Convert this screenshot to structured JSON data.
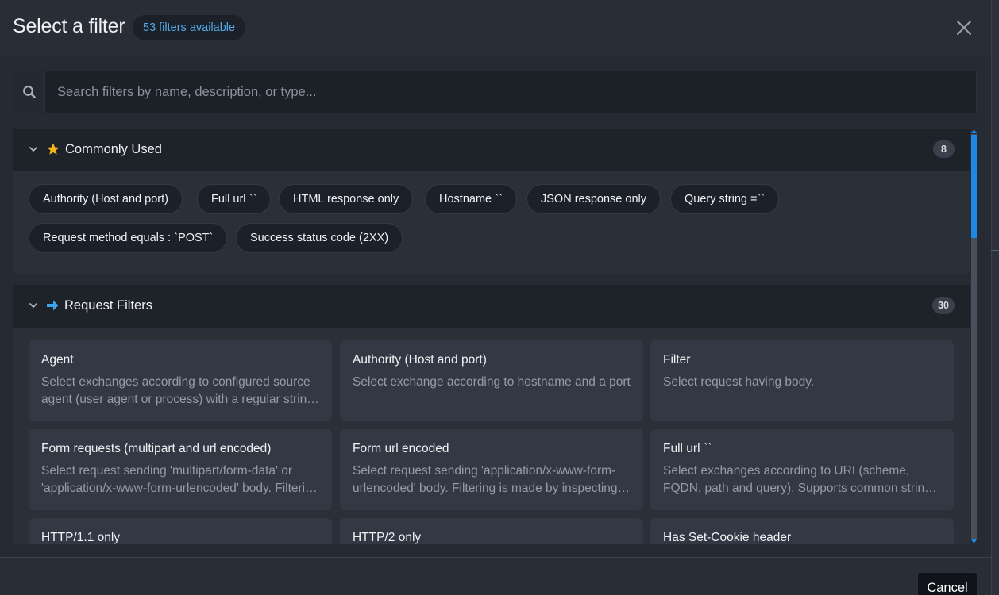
{
  "header": {
    "title": "Select a filter",
    "count_badge": "53 filters available"
  },
  "search": {
    "placeholder": "Search filters by name, description, or type...",
    "value": ""
  },
  "sections": [
    {
      "title": "Commonly Used",
      "icon": "star-icon",
      "count": "8",
      "chips": [
        "Authority (Host and port)",
        "Full url ``",
        "HTML response only",
        "Hostname ``",
        "JSON response only",
        "Query string =``",
        "Request method equals : `POST`",
        "Success status code (2XX)"
      ]
    },
    {
      "title": "Request Filters",
      "icon": "arrow-right-icon",
      "count": "30",
      "cards": [
        {
          "title": "Agent",
          "desc": "Select exchanges according to configured source agent (user agent or process) with a regular string search"
        },
        {
          "title": "Authority (Host and port)",
          "desc": "Select exchange according to hostname and a port"
        },
        {
          "title": "Filter",
          "desc": "Select request having body."
        },
        {
          "title": "Form requests (multipart and url encoded)",
          "desc": "Select request sending 'multipart/form-data' or 'application/x-www-form-urlencoded' body. Filtering is made by inspecting the content-type header"
        },
        {
          "title": "Form url encoded",
          "desc": "Select request sending 'application/x-www-form-urlencoded' body. Filtering is made by inspecting the content-type header"
        },
        {
          "title": "Full url ``",
          "desc": "Select exchanges according to URI (scheme, FQDN, path and query). Supports common string search operators"
        },
        {
          "title": "HTTP/1.1 only",
          "desc": ""
        },
        {
          "title": "HTTP/2 only",
          "desc": ""
        },
        {
          "title": "Has Set-Cookie header",
          "desc": ""
        }
      ]
    }
  ],
  "footer": {
    "cancel_label": "Cancel"
  },
  "colors": {
    "accent": "#1e88e5",
    "badge_text": "#53a9e8",
    "star": "#f5b619",
    "arrow": "#3ba4ea"
  }
}
